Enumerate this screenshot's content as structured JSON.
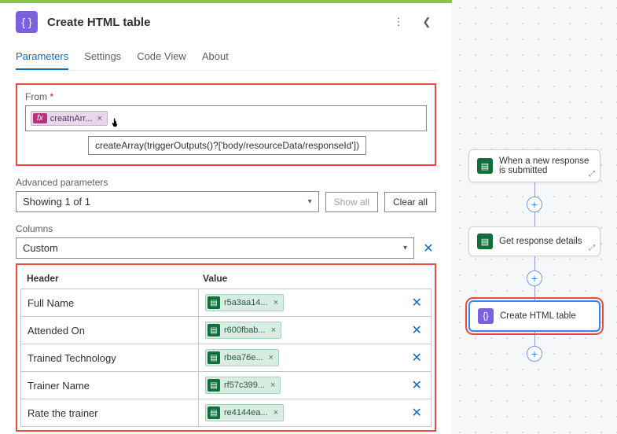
{
  "header": {
    "title": "Create HTML table",
    "icon": "code-braces-icon"
  },
  "tabs": [
    "Parameters",
    "Settings",
    "Code View",
    "About"
  ],
  "activeTab": 0,
  "from": {
    "label": "From",
    "required": "*",
    "token": {
      "fx": "fx",
      "text": "creatnArr...",
      "remove": "×"
    },
    "tooltip": "createArray(triggerOutputs()?['body/resourceData/responseId'])"
  },
  "advanced": {
    "label": "Advanced parameters",
    "selected": "Showing 1 of 1",
    "showAll": "Show all",
    "clearAll": "Clear all"
  },
  "columns": {
    "label": "Columns",
    "selected": "Custom",
    "headers": {
      "header": "Header",
      "value": "Value"
    },
    "rows": [
      {
        "header": "Full Name",
        "value": "r5a3aa14..."
      },
      {
        "header": "Attended On",
        "value": "r600fbab..."
      },
      {
        "header": "Trained Technology",
        "value": "rbea76e..."
      },
      {
        "header": "Trainer Name",
        "value": "rf57c399..."
      },
      {
        "header": "Rate the trainer",
        "value": "re4144ea..."
      }
    ],
    "remove": "×"
  },
  "flow": {
    "trigger": "When a new response is submitted",
    "action1": "Get response details",
    "action2": "Create HTML table",
    "plus": "+"
  }
}
